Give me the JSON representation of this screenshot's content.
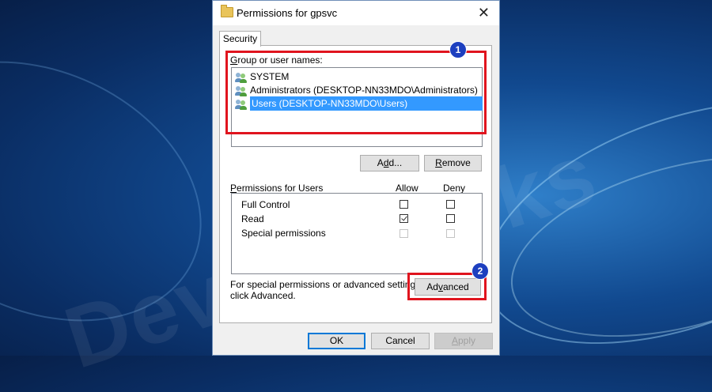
{
  "window": {
    "title": "Permissions for gpsvc"
  },
  "tab": {
    "label": "Security"
  },
  "group_section": {
    "label_first": "G",
    "label_rest": "roup or user names:",
    "items": [
      {
        "name": "SYSTEM",
        "selected": false
      },
      {
        "name": "Administrators (DESKTOP-NN33MDO\\Administrators)",
        "selected": false
      },
      {
        "name": "Users (DESKTOP-NN33MDO\\Users)",
        "selected": true
      }
    ]
  },
  "buttons": {
    "add_pre": "A",
    "add_u": "d",
    "add_post": "d...",
    "remove_pre": "",
    "remove_u": "R",
    "remove_post": "emove",
    "advanced_pre": "Ad",
    "advanced_u": "v",
    "advanced_post": "anced",
    "ok": "OK",
    "cancel": "Cancel",
    "apply_u": "A",
    "apply_post": "pply"
  },
  "permissions": {
    "label_pre": "",
    "label_u": "P",
    "label_post": "ermissions for Users",
    "allow_header": "Allow",
    "deny_header": "Deny",
    "rows": [
      {
        "name": "Full Control",
        "allow": false,
        "deny": false,
        "disabled": false
      },
      {
        "name": "Read",
        "allow": true,
        "deny": false,
        "disabled": false
      },
      {
        "name": "Special permissions",
        "allow": false,
        "deny": false,
        "disabled": true
      }
    ]
  },
  "advanced_note": {
    "line1": "For special permissions or advanced settings,",
    "line2": "click Advanced."
  },
  "badges": {
    "one": "1",
    "two": "2"
  },
  "watermark": "DeviceTricks",
  "colors": {
    "highlight": "#e0141e",
    "badge": "#1d3fbf",
    "selection": "#3399ff"
  }
}
